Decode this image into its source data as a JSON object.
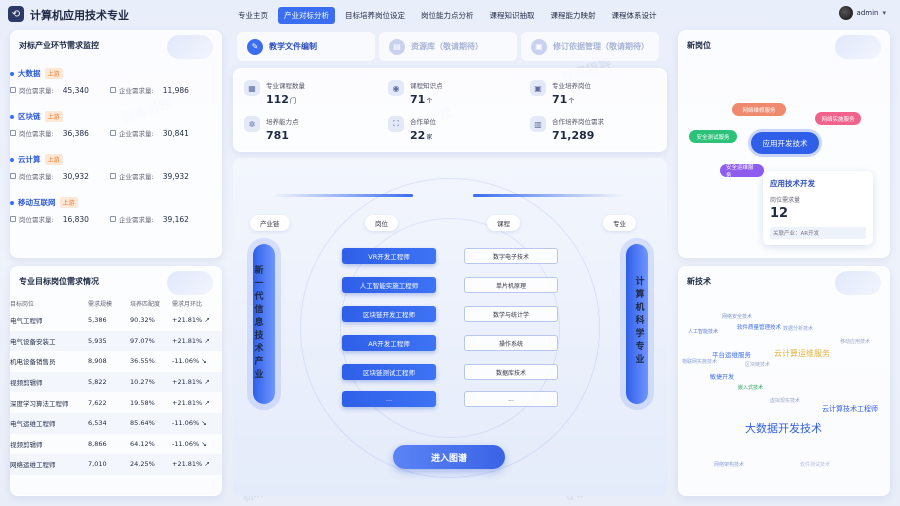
{
  "app": {
    "title": "计算机应用技术专业"
  },
  "nav": [
    "专业主页",
    "产业对标分析",
    "目标培养岗位设定",
    "岗位能力点分析",
    "课程知识抽取",
    "课程能力映射",
    "课程体系设计"
  ],
  "user": {
    "name": "admin"
  },
  "industry_panel": {
    "title": "对标产业环节需求监控",
    "items": [
      {
        "name": "大数据",
        "tag": "上游",
        "job_label": "岗位需求量:",
        "job_value": "45,340",
        "ent_label": "企业需求量:",
        "ent_value": "11,986"
      },
      {
        "name": "区块链",
        "tag": "上游",
        "job_label": "岗位需求量:",
        "job_value": "36,386",
        "ent_label": "企业需求量:",
        "ent_value": "30,841"
      },
      {
        "name": "云计算",
        "tag": "上游",
        "job_label": "岗位需求量:",
        "job_value": "30,932",
        "ent_label": "企业需求量:",
        "ent_value": "39,932"
      },
      {
        "name": "移动互联网",
        "tag": "上游",
        "job_label": "岗位需求量:",
        "job_value": "16,830",
        "ent_label": "企业需求量:",
        "ent_value": "39,162"
      }
    ]
  },
  "jobs_panel": {
    "title": "专业目标岗位需求情况",
    "columns": [
      "目标岗位",
      "需求规模",
      "培养匹配度",
      "需求月环比"
    ],
    "rows": [
      {
        "job": "电气工程师",
        "scale": "5,386",
        "match": "90.32%",
        "mom": "+21.81%",
        "dir": "up"
      },
      {
        "job": "电气设备安装工",
        "scale": "5,935",
        "match": "97.07%",
        "mom": "+21.81%",
        "dir": "up"
      },
      {
        "job": "机电设备销售员",
        "scale": "8,908",
        "match": "36.55%",
        "mom": "-11.06%",
        "dir": "down"
      },
      {
        "job": "视频剪辑师",
        "scale": "5,822",
        "match": "10.27%",
        "mom": "+21.81%",
        "dir": "up"
      },
      {
        "job": "深度学习算法工程师",
        "scale": "7,622",
        "match": "19.58%",
        "mom": "+21.81%",
        "dir": "up"
      },
      {
        "job": "电气运维工程师",
        "scale": "6,534",
        "match": "85.64%",
        "mom": "-11.06%",
        "dir": "down"
      },
      {
        "job": "视频剪辑师",
        "scale": "8,866",
        "match": "64.12%",
        "mom": "-11.06%",
        "dir": "down"
      },
      {
        "job": "网络运维工程师",
        "scale": "7,010",
        "match": "24.25%",
        "mom": "+21.81%",
        "dir": "up"
      }
    ]
  },
  "tabs": [
    {
      "label": "教学文件编制",
      "active": true
    },
    {
      "label": "资源库（敬请期待）",
      "active": false
    },
    {
      "label": "修订依据管理（敬请期待）",
      "active": false
    }
  ],
  "stats": [
    {
      "label": "专业课程数量",
      "value": "112",
      "unit": "门"
    },
    {
      "label": "课程知识点",
      "value": "71",
      "unit": "个"
    },
    {
      "label": "专业培养岗位",
      "value": "71",
      "unit": "个"
    },
    {
      "label": "培养能力点",
      "value": "781",
      "unit": ""
    },
    {
      "label": "合作单位",
      "value": "22",
      "unit": "家"
    },
    {
      "label": "合作培养岗位需求",
      "value": "71,289",
      "unit": ""
    }
  ],
  "map": {
    "col_industry": "产业链",
    "col_job": "岗位",
    "col_course": "课程",
    "col_major": "专业",
    "left_pillar": "新一代信息技术产业",
    "right_pillar": "计算机科学专业",
    "jobs": [
      "VR开发工程师",
      "人工智能实施工程师",
      "区块链开发工程师",
      "AR开发工程师",
      "区块链测试工程师",
      "..."
    ],
    "courses": [
      "数字电子技术",
      "单片机原理",
      "数学与统计学",
      "操作系统",
      "数据库技术",
      "..."
    ],
    "enter_label": "进入图谱"
  },
  "new_jobs": {
    "title": "新岗位",
    "bubbles": [
      {
        "label": "网络维修服务",
        "color": "#f08a6e"
      },
      {
        "label": "网络实施服务",
        "color": "#f2638c"
      },
      {
        "label": "安全测试服务",
        "color": "#2cc27a"
      },
      {
        "label": "应用开发技术",
        "color": "#2f5fe8"
      },
      {
        "label": "安全运维服务",
        "color": "#8f5cf0"
      }
    ],
    "card": {
      "title": "应用技术开发",
      "sub": "岗位需求量",
      "value": "12",
      "foot": "关联产业：AR开发"
    }
  },
  "new_tech": {
    "title": "新技术",
    "words": [
      "网络安全技术",
      "软件质量管理技术",
      "数据分析技术",
      "人工智能技术",
      "移动应用技术",
      "平台运维服务",
      "云计算运维服务",
      "物联网实施技术",
      "区块链技术",
      "敏捷开发",
      "嵌入式技术",
      "虚拟现实技术",
      "云计算技术工程师",
      "大数据开发技术",
      "网络架构技术",
      "软件测试技术"
    ]
  }
}
